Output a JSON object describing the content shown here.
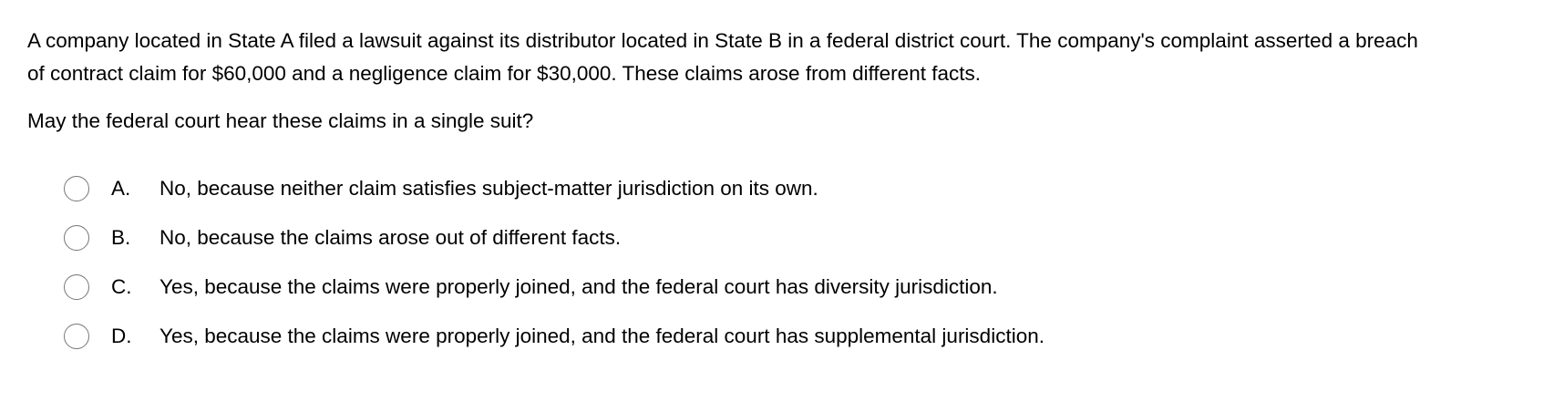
{
  "question": {
    "stem": "A company located in State A filed a lawsuit against its distributor located in State B in a federal district court.  The company's complaint asserted a breach of contract claim for $60,000 and a negligence claim for $30,000.  These claims arose from different facts.",
    "prompt": "May the federal court hear these claims in a single suit?"
  },
  "options": [
    {
      "letter": "A.",
      "text": "No, because neither claim satisfies subject-matter jurisdiction on its own.",
      "selected": false
    },
    {
      "letter": "B.",
      "text": "No, because the claims arose out of different facts.",
      "selected": false
    },
    {
      "letter": "C.",
      "text": "Yes, because the claims were properly joined, and the federal court has diversity jurisdiction.",
      "selected": false
    },
    {
      "letter": "D.",
      "text": "Yes, because the claims were properly joined, and the federal court has supplemental jurisdiction.",
      "selected": false
    }
  ]
}
